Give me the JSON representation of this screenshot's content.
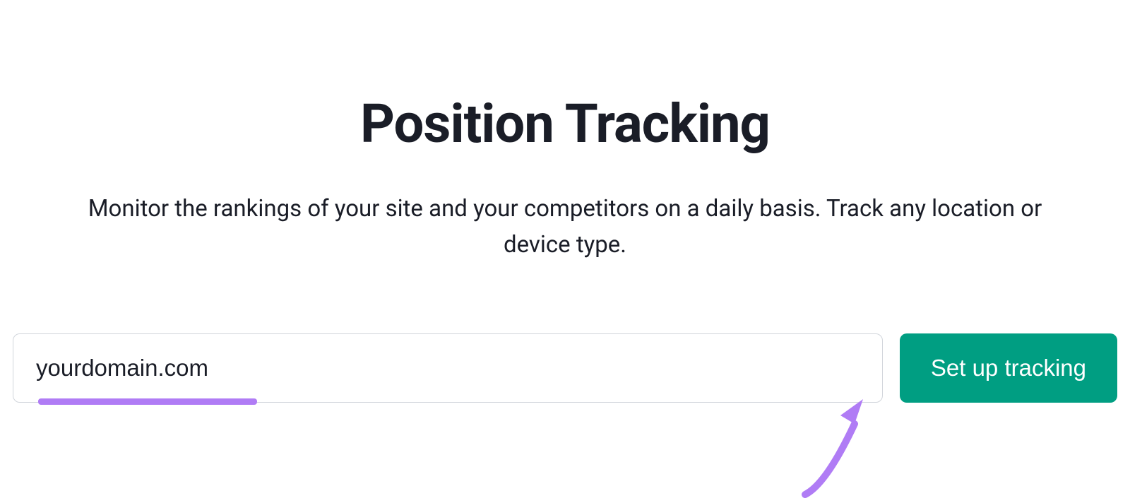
{
  "header": {
    "title": "Position Tracking",
    "subtitle": "Monitor the rankings of your site and your competitors on a daily basis. Track any location or device type."
  },
  "form": {
    "domain_value": "yourdomain.com",
    "submit_label": "Set up tracking"
  },
  "colors": {
    "accent_green": "#009e82",
    "annotation_purple": "#b07cf5",
    "text_dark": "#1a1d27"
  }
}
